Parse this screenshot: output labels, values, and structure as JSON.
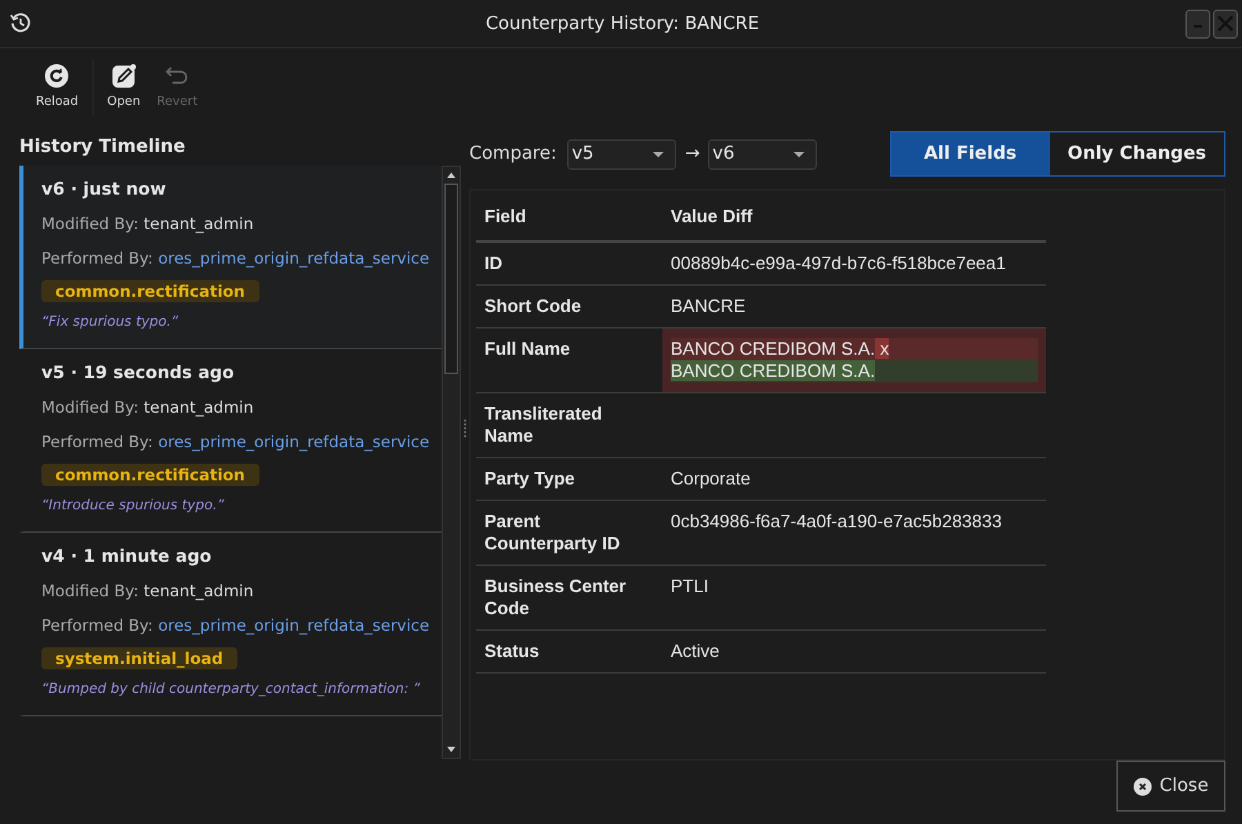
{
  "window": {
    "title": "Counterparty History: BANCRE"
  },
  "toolbar": [
    {
      "kind": "reload",
      "label": "Reload",
      "disabled": false
    },
    {
      "kind": "open",
      "label": "Open",
      "disabled": false
    },
    {
      "kind": "revert",
      "label": "Revert",
      "disabled": true
    }
  ],
  "timeline": {
    "title": "History Timeline",
    "entries": [
      {
        "heading": "v6 · just now",
        "modified_label": "Modified By:",
        "modified_by": "tenant_admin",
        "performed_label": "Performed By:",
        "performed_by": "ores_prime_origin_refdata_service",
        "tag": "common.rectification",
        "note": "“Fix spurious typo.”",
        "selected": true
      },
      {
        "heading": "v5 · 19 seconds ago",
        "modified_label": "Modified By:",
        "modified_by": "tenant_admin",
        "performed_label": "Performed By:",
        "performed_by": "ores_prime_origin_refdata_service",
        "tag": "common.rectification",
        "note": "“Introduce spurious typo.”",
        "selected": false
      },
      {
        "heading": "v4 · 1 minute ago",
        "modified_label": "Modified By:",
        "modified_by": "tenant_admin",
        "performed_label": "Performed By:",
        "performed_by": "ores_prime_origin_refdata_service",
        "tag": "system.initial_load",
        "note": "“Bumped by child counterparty_contact_information: ”",
        "selected": false
      }
    ]
  },
  "compare": {
    "label": "Compare:",
    "from": "v5",
    "arrow": "→",
    "to": "v6"
  },
  "view_toggle": [
    {
      "label": "All Fields",
      "selected": true
    },
    {
      "label": "Only Changes",
      "selected": false
    }
  ],
  "table": {
    "columns": [
      "Field",
      "Value Diff"
    ],
    "rows": [
      {
        "kind": "plain",
        "field": "ID",
        "value": "00889b4c-e99a-497d-b7c6-f518bce7eea1"
      },
      {
        "kind": "plain",
        "field": "Short Code",
        "value": "BANCRE"
      },
      {
        "kind": "diff",
        "field": "Full Name",
        "removed": [
          {
            "text": "BANCO CREDIBOM S.A.",
            "changed": false
          },
          {
            "text": " x",
            "changed": true
          }
        ],
        "added": [
          {
            "text": "BANCO CREDIBOM S.A.",
            "changed": true
          }
        ]
      },
      {
        "kind": "plain",
        "field": "Transliterated Name"
      },
      {
        "kind": "plain",
        "field": "Party Type",
        "value": "Corporate"
      },
      {
        "kind": "plain",
        "field": "Parent Counterparty ID",
        "value": "0cb34986-f6a7-4a0f-a190-e7ac5b283833"
      },
      {
        "kind": "plain",
        "field": "Business Center Code",
        "value": "PTLI"
      },
      {
        "kind": "plain",
        "field": "Status",
        "value": "Active"
      }
    ]
  },
  "close_button": {
    "label": "Close"
  }
}
